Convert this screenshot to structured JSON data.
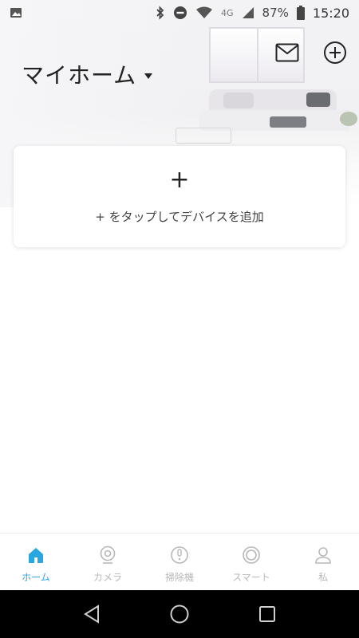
{
  "status_bar": {
    "left_icons": [
      "image-notification-icon"
    ],
    "right_icons": [
      "bluetooth-icon",
      "do-not-disturb-icon",
      "wifi-icon",
      "signal-icon",
      "battery-icon"
    ],
    "network_type": "4G",
    "battery_percent": "87%",
    "time": "15:20"
  },
  "header": {
    "home_name": "マイホーム",
    "actions": [
      "mail-icon",
      "add-circle-icon"
    ]
  },
  "add_card": {
    "plus": "+",
    "hint": "+ をタップしてデバイスを追加"
  },
  "bottom_nav": {
    "items": [
      {
        "label": "ホーム",
        "icon": "home-icon",
        "active": true
      },
      {
        "label": "カメラ",
        "icon": "camera-icon",
        "active": false
      },
      {
        "label": "掃除機",
        "icon": "vacuum-icon",
        "active": false
      },
      {
        "label": "スマート",
        "icon": "smart-icon",
        "active": false
      },
      {
        "label": "私",
        "icon": "person-icon",
        "active": false
      }
    ]
  },
  "system_nav": [
    "back-icon",
    "home-circle-icon",
    "recents-icon"
  ],
  "colors": {
    "accent": "#2aa7e0",
    "inactive": "#b8b8b8",
    "system_bar": "#000000"
  }
}
